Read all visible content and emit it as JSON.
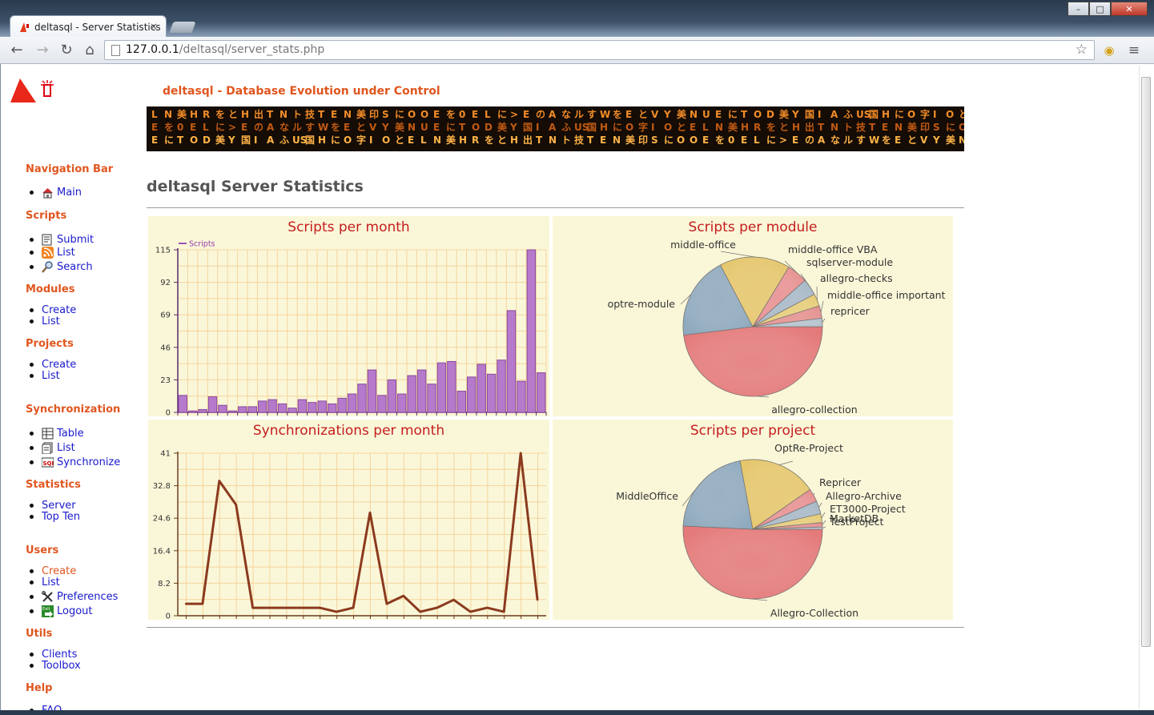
{
  "browser": {
    "tab_title": "deltasql - Server Statistics",
    "tab_close": "×",
    "url_host": "127.0.0.1",
    "url_path": "/deltasql/server_stats.php",
    "window_min": "–",
    "window_max": "□",
    "window_close": "✕"
  },
  "site": {
    "title": "deltasql - Database Evolution under Control",
    "page_title": "deltasql Server Statistics",
    "banner_glyphs": [
      "L",
      "E",
      "E",
      "N",
      "を",
      "に",
      "美",
      "0",
      "T",
      "H",
      "E",
      "O",
      "R",
      "L",
      "D",
      "を",
      "に",
      "美",
      "と",
      ">",
      "Y",
      "H",
      "E",
      "国",
      "出",
      "の",
      "I",
      "T",
      "A",
      "A",
      "N",
      "な",
      "ふ",
      "ト",
      "ル",
      "US",
      "技",
      "す",
      "国",
      "T",
      "W",
      "H",
      "E",
      "を",
      "に",
      "N",
      "E",
      "O",
      "美",
      "と",
      "字",
      "印",
      "V",
      "I",
      "S",
      "Y",
      "O",
      "に",
      "美",
      "と",
      "O",
      "N",
      "E",
      "O",
      "U"
    ]
  },
  "nav": {
    "sections": [
      {
        "heading": "Navigation Bar",
        "items": [
          {
            "label": "Main",
            "icon": "home-icon"
          }
        ]
      },
      {
        "heading": "Scripts",
        "items": [
          {
            "label": "Submit",
            "icon": "submit-icon"
          },
          {
            "label": "List",
            "icon": "rss-icon"
          },
          {
            "label": "Search",
            "icon": "search-icon"
          }
        ]
      },
      {
        "heading": "Modules",
        "items": [
          {
            "label": "Create"
          },
          {
            "label": "List"
          }
        ]
      },
      {
        "heading": "Projects",
        "items": [
          {
            "label": "Create"
          },
          {
            "label": "List"
          }
        ]
      },
      {
        "heading": "Synchronization",
        "items": [
          {
            "label": "Table",
            "icon": "table-icon"
          },
          {
            "label": "List",
            "icon": "list-icon"
          },
          {
            "label": "Synchronize",
            "icon": "sql-icon"
          }
        ]
      },
      {
        "heading": "Statistics",
        "items": [
          {
            "label": "Server"
          },
          {
            "label": "Top Ten"
          }
        ]
      },
      {
        "heading": "Users",
        "items": [
          {
            "label": "Create"
          },
          {
            "label": "List"
          },
          {
            "label": "Preferences",
            "icon": "tools-icon"
          },
          {
            "label": "Logout",
            "icon": "exit-icon"
          }
        ]
      },
      {
        "heading": "Utils",
        "items": [
          {
            "label": "Clients"
          },
          {
            "label": "Toolbox"
          }
        ]
      },
      {
        "heading": "Help",
        "items": [
          {
            "label": "FAQ"
          }
        ]
      }
    ]
  },
  "colors": {
    "accent": "#e0561f",
    "link": "#1a1acc",
    "panel_bg": "#faf7d9",
    "chart_title": "#c41d1d",
    "bar_fill": "#b57acb",
    "line_color": "#8b3a1e"
  },
  "chart_data": [
    {
      "type": "bar",
      "title": "Scripts per month",
      "series": [
        {
          "name": "Scripts",
          "values": [
            12,
            1,
            2,
            11,
            5,
            1,
            4,
            4,
            8,
            9,
            6,
            3,
            9,
            7,
            8,
            6,
            10,
            13,
            20,
            30,
            12,
            23,
            13,
            26,
            30,
            20,
            35,
            36,
            15,
            25,
            34,
            27,
            37,
            72,
            22,
            115,
            28
          ]
        }
      ],
      "yticks": [
        "0",
        "23",
        "46",
        "69",
        "92",
        "115"
      ],
      "ylim": [
        0,
        115
      ],
      "grid": true,
      "legend": "top-left"
    },
    {
      "type": "pie",
      "title": "Scripts per module",
      "labels": [
        "allegro-collection",
        "optre-module",
        "middle-office",
        "middle-office VBA",
        "sqlserver-module",
        "allegro-checks",
        "middle-office important",
        "repricer"
      ],
      "values": [
        50,
        20,
        17,
        5,
        4,
        3,
        3,
        2
      ]
    },
    {
      "type": "line",
      "title": "Synchronizations per month",
      "series": [
        {
          "values": [
            3,
            3,
            34,
            28,
            2,
            2,
            2,
            2,
            2,
            1,
            2,
            26,
            3,
            5,
            1,
            2,
            4,
            1,
            2,
            1,
            41,
            4
          ]
        }
      ],
      "yticks": [
        "0",
        "8.2",
        "16.4",
        "24.6",
        "32.8",
        "41"
      ],
      "ylim": [
        0,
        41
      ],
      "grid": true
    },
    {
      "type": "pie",
      "title": "Scripts per project",
      "labels": [
        "Allegro-Collection",
        "MiddleOffice",
        "OptRe-Project",
        "Repricer",
        "Allegro-Archive",
        "ET3000-Project",
        "MarketDB",
        "TestProject"
      ],
      "values": [
        50,
        21,
        18,
        3,
        3,
        2,
        1,
        0.5
      ]
    }
  ]
}
